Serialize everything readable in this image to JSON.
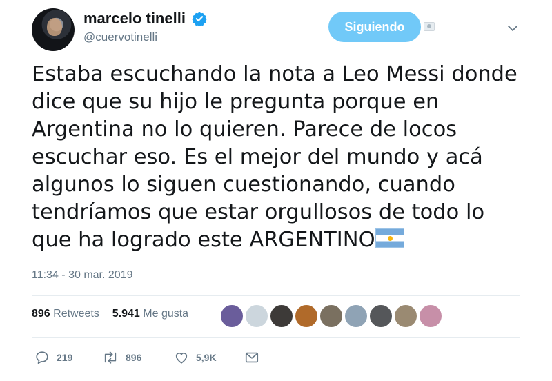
{
  "author": {
    "display_name": "marcelo tinelli",
    "handle": "@cuervotinelli",
    "verified": true
  },
  "follow_button": {
    "label": "Siguiendo"
  },
  "tweet": {
    "lines": [
      "Estaba escuchando la nota a Leo Messi donde",
      "dice que su hijo le pregunta porque en",
      "Argentina no lo quieren. Parece de locos",
      "escuchar eso. Es el mejor del mundo y acá",
      "algunos lo siguen cuestionando, cuando",
      "tendríamos que estar orgullosos de todo lo",
      "que ha logrado este ARGENTINO"
    ],
    "emoji": "argentina-flag-emoji",
    "timestamp": "11:34 - 30 mar. 2019"
  },
  "stats": {
    "retweets_count": "896",
    "retweets_label": "Retweets",
    "likes_count": "5.941",
    "likes_label": "Me gusta"
  },
  "liker_avatar_colors": [
    "#6a5d9b",
    "#ccd6dd",
    "#3d3a38",
    "#b06a2a",
    "#7a7060",
    "#8fa3b5",
    "#55575a",
    "#9a8a72",
    "#c78fa8"
  ],
  "actions": {
    "reply_count": "219",
    "retweet_count": "896",
    "like_count": "5,9K"
  },
  "colors": {
    "accent": "#1da1f2",
    "follow_button": "#71c9f8",
    "secondary_text": "#657786",
    "divider": "#e6ecf0"
  }
}
